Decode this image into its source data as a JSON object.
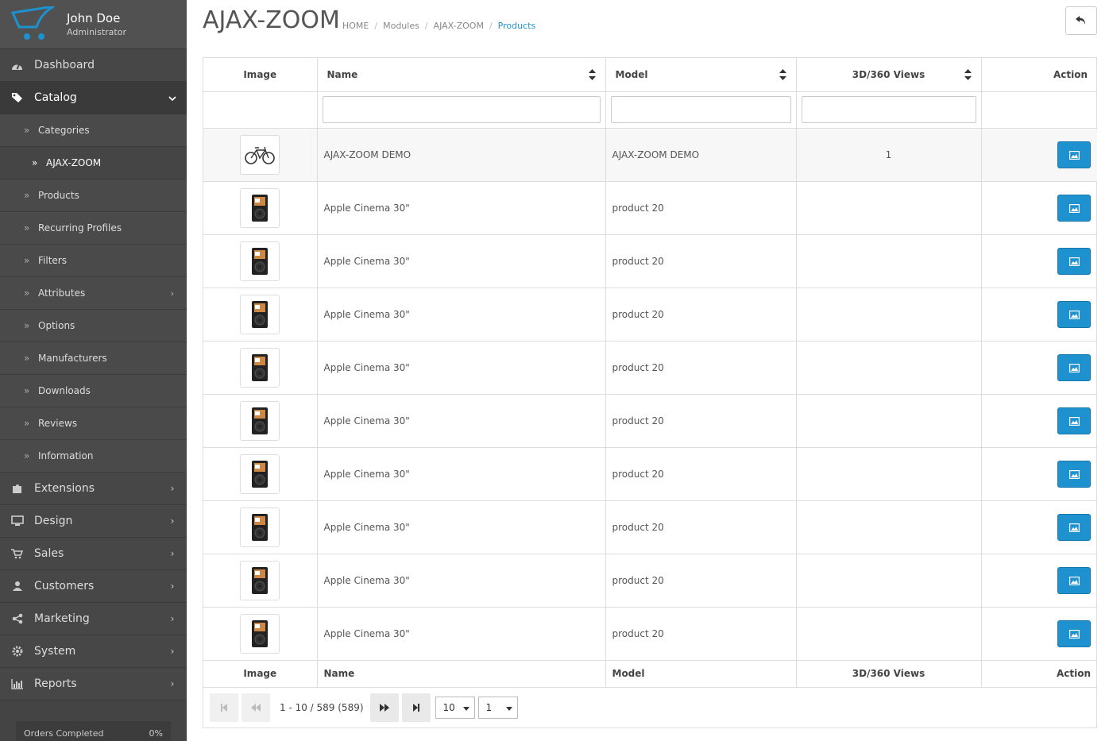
{
  "user": {
    "name": "John Doe",
    "role": "Administrator"
  },
  "sidebar": {
    "items": [
      {
        "label": "Dashboard",
        "icon": "dashboard-icon"
      },
      {
        "label": "Catalog",
        "icon": "tags-icon"
      },
      {
        "label": "Extensions",
        "icon": "puzzle-icon"
      },
      {
        "label": "Design",
        "icon": "monitor-icon"
      },
      {
        "label": "Sales",
        "icon": "cart-icon"
      },
      {
        "label": "Customers",
        "icon": "user-icon"
      },
      {
        "label": "Marketing",
        "icon": "share-icon"
      },
      {
        "label": "System",
        "icon": "cog-icon"
      },
      {
        "label": "Reports",
        "icon": "bar-chart-icon"
      }
    ],
    "catalog_sub": [
      {
        "label": "Categories"
      },
      {
        "label": "AJAX-ZOOM"
      },
      {
        "label": "Products"
      },
      {
        "label": "Recurring Profiles"
      },
      {
        "label": "Filters"
      },
      {
        "label": "Attributes"
      },
      {
        "label": "Options"
      },
      {
        "label": "Manufacturers"
      },
      {
        "label": "Downloads"
      },
      {
        "label": "Reviews"
      },
      {
        "label": "Information"
      }
    ],
    "orders": {
      "label": "Orders Completed",
      "value": "0%"
    }
  },
  "page": {
    "title": "AJAX-ZOOM",
    "breadcrumb": [
      "HOME",
      "Modules",
      "AJAX-ZOOM",
      "Products"
    ]
  },
  "table": {
    "headers": {
      "image": "Image",
      "name": "Name",
      "model": "Model",
      "views": "3D/360 Views",
      "action": "Action"
    },
    "rows": [
      {
        "name": "AJAX-ZOOM DEMO",
        "model": "AJAX-ZOOM DEMO",
        "views": "1",
        "image": "bicycle-image"
      },
      {
        "name": "Apple Cinema 30\"",
        "model": "product 20",
        "views": "",
        "image": "ipod-image"
      },
      {
        "name": "Apple Cinema 30\"",
        "model": "product 20",
        "views": "",
        "image": "ipod-image"
      },
      {
        "name": "Apple Cinema 30\"",
        "model": "product 20",
        "views": "",
        "image": "ipod-image"
      },
      {
        "name": "Apple Cinema 30\"",
        "model": "product 20",
        "views": "",
        "image": "ipod-image"
      },
      {
        "name": "Apple Cinema 30\"",
        "model": "product 20",
        "views": "",
        "image": "ipod-image"
      },
      {
        "name": "Apple Cinema 30\"",
        "model": "product 20",
        "views": "",
        "image": "ipod-image"
      },
      {
        "name": "Apple Cinema 30\"",
        "model": "product 20",
        "views": "",
        "image": "ipod-image"
      },
      {
        "name": "Apple Cinema 30\"",
        "model": "product 20",
        "views": "",
        "image": "ipod-image"
      },
      {
        "name": "Apple Cinema 30\"",
        "model": "product 20",
        "views": "",
        "image": "ipod-image"
      }
    ]
  },
  "pager": {
    "info": "1 - 10 / 589 (589)",
    "per_page": "10",
    "page": "1"
  },
  "colors": {
    "accent": "#1e91cf",
    "sidebar": "#444444"
  }
}
